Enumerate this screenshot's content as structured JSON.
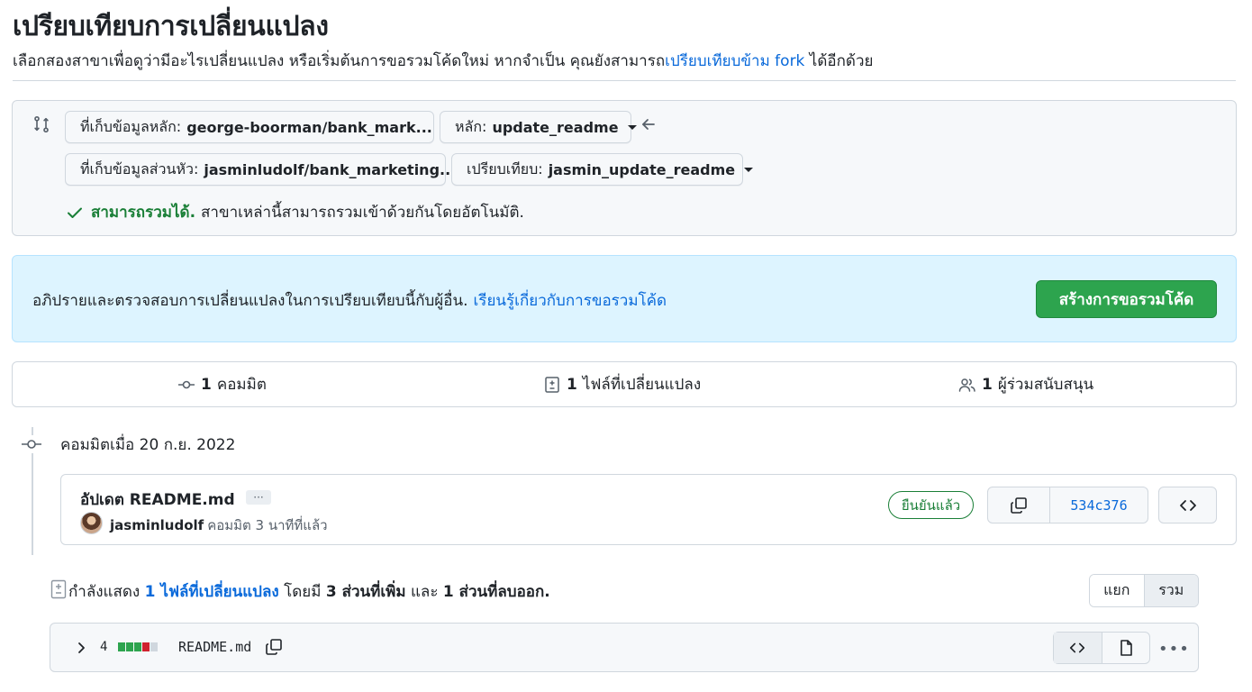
{
  "header": {
    "title": "เปรียบเทียบการเปลี่ยนแปลง",
    "subtitle_prefix": "เลือกสองสาขาเพื่อดูว่ามีอะไรเปลี่ยนแปลง หรือเริ่มต้นการขอรวมโค้ดใหม่ หากจำเป็น คุณยังสามารถ",
    "subtitle_link": "เปรียบเทียบข้าม fork",
    "subtitle_suffix": " ได้อีกด้วย"
  },
  "range": {
    "base_repo_label": "ที่เก็บข้อมูลหลัก:",
    "base_repo_value": "george-boorman/bank_mark...",
    "base_branch_label": "หลัก:",
    "base_branch_value": "update_readme",
    "head_repo_label": "ที่เก็บข้อมูลส่วนหัว:",
    "head_repo_value": "jasminludolf/bank_marketing...",
    "compare_label": "เปรียบเทียบ:",
    "compare_value": "jasmin_update_readme",
    "mergeable_status": "สามารถรวมได้.",
    "mergeable_text": "สาขาเหล่านี้สามารถรวมเข้าด้วยกันโดยอัตโนมัติ."
  },
  "banner": {
    "text": "อภิปรายและตรวจสอบการเปลี่ยนแปลงในการเปรียบเทียบนี้กับผู้อื่น.",
    "link": "เรียนรู้เกี่ยวกับการขอรวมโค้ด",
    "button": "สร้างการขอรวมโค้ด"
  },
  "summary": {
    "commits_count": "1",
    "commits_label": "คอมมิต",
    "files_count": "1",
    "files_label": "ไฟล์ที่เปลี่ยนแปลง",
    "contributors_count": "1",
    "contributors_label": "ผู้ร่วมสนับสนุน"
  },
  "timeline": {
    "date_heading": "คอมมิตเมื่อ 20 ก.ย. 2022",
    "commit": {
      "title": "อัปเดต README.md",
      "ellipsis": "···",
      "author": "jasminludolf",
      "meta": "คอมมิต 3 นาทีที่แล้ว",
      "verified": "ยืนยันแล้ว",
      "sha": "534c376"
    }
  },
  "toc": {
    "prefix": "กำลังแสดง",
    "files_link": "1 ไฟล์ที่เปลี่ยนแปลง",
    "middle": "โดยมี",
    "additions": "3 ส่วนที่เพิ่ม",
    "and": "และ",
    "deletions": "1 ส่วนที่ลบออก.",
    "split_label": "แยก",
    "unified_label": "รวม"
  },
  "file": {
    "changes": "4",
    "name": "README.md",
    "diffstat": [
      "add",
      "add",
      "add",
      "del",
      "neutral"
    ]
  },
  "colors": {
    "add": "#2da44e",
    "del": "#cf222e",
    "neutral": "#d0d7de",
    "link": "#0969da",
    "success": "#1a7f37"
  }
}
